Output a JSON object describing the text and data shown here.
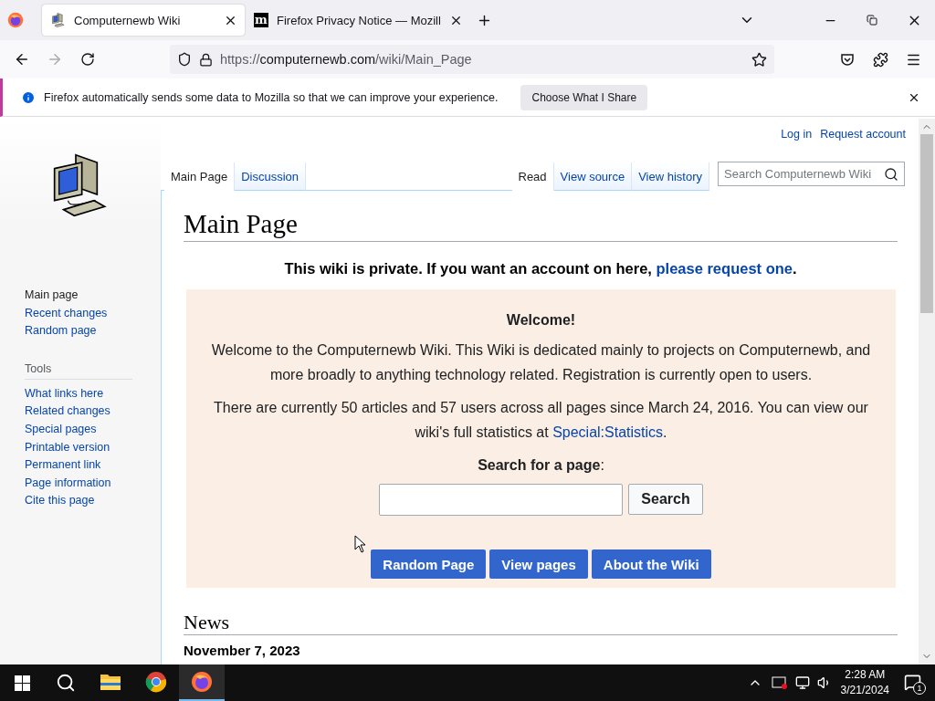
{
  "browser": {
    "tabs": [
      {
        "title": "Computernewb Wiki",
        "selected": true,
        "kind": "computer"
      },
      {
        "title": "Firefox Privacy Notice — Mozill",
        "selected": false,
        "kind": "letter",
        "favicon_text": "m"
      }
    ],
    "url": {
      "scheme": "https://",
      "host": "computernewb.com",
      "path": "/wiki/Main_Page"
    },
    "notification": {
      "text": "Firefox automatically sends some data to Mozilla so that we can improve your experience.",
      "button": "Choose What I Share"
    }
  },
  "wiki": {
    "personal_links": [
      "Log in",
      "Request account"
    ],
    "navigation": [
      {
        "label": "Main page",
        "selected": true
      },
      {
        "label": "Recent changes",
        "selected": false
      },
      {
        "label": "Random page",
        "selected": false
      }
    ],
    "tools_heading": "Tools",
    "tools": [
      "What links here",
      "Related changes",
      "Special pages",
      "Printable version",
      "Permanent link",
      "Page information",
      "Cite this page"
    ],
    "left_tabs": [
      {
        "label": "Main Page",
        "selected": true
      },
      {
        "label": "Discussion",
        "selected": false
      }
    ],
    "right_tabs": [
      {
        "label": "Read",
        "selected": true
      },
      {
        "label": "View source",
        "selected": false
      },
      {
        "label": "View history",
        "selected": false
      }
    ],
    "search_placeholder": "Search Computernewb Wiki",
    "title": "Main Page",
    "notice": {
      "text": "This wiki is private. If you want an account on here, ",
      "link": "please request one",
      "after": "."
    },
    "welcome": {
      "heading": "Welcome!",
      "paragraph_1": "Welcome to the Computernewb Wiki. This Wiki is dedicated mainly to projects on Computernewb, and more broadly to anything technology related. Registration is currently open to users.",
      "paragraph_2": {
        "text": "There are currently 50 articles and 57 users across all pages since March 24, 2016. You can view our wiki's full statistics at ",
        "link": "Special:Statistics",
        "after": "."
      },
      "search_label": "Search for a page",
      "search_label_after": ":",
      "search_button": "Search",
      "buttons": [
        "Random Page",
        "View pages",
        "About the Wiki"
      ]
    },
    "news_heading": "News",
    "news_date": "November 7, 2023"
  },
  "taskbar": {
    "apps": [
      {
        "kind": "explorer",
        "selected": false
      },
      {
        "kind": "chrome",
        "selected": false
      },
      {
        "kind": "firefox",
        "selected": true
      }
    ],
    "time": "2:28 AM",
    "date": "3/21/2024",
    "notification_count": "1"
  }
}
